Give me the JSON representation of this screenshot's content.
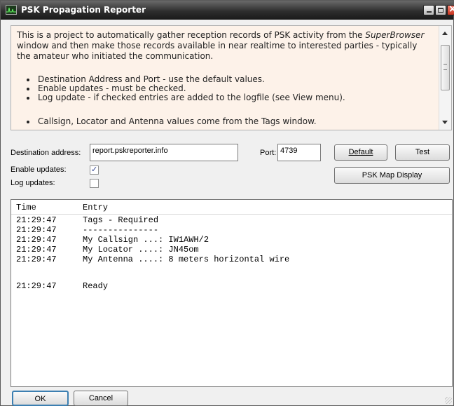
{
  "window": {
    "title": "PSK Propagation Reporter"
  },
  "info": {
    "para_before": "This is a project to automatically gather reception records of PSK activity from the ",
    "para_italic": "SuperBrowser",
    "para_after": " window and then make those records available in near realtime to interested parties - typically the amateur who initiated the communication.",
    "bullets": [
      "Destination Address and Port - use the default values.",
      "Enable updates - must be checked.",
      "Log update - if checked entries are added to the logfile (see View menu)."
    ],
    "bullets_2": [
      "Callsign, Locator and Antenna values come from the Tags window."
    ]
  },
  "form": {
    "dest_label": "Destination address:",
    "dest_value": "report.pskreporter.info",
    "port_label": "Port:",
    "port_value": "4739",
    "enable_label": "Enable updates:",
    "enable_checked": true,
    "log_label": "Log updates:",
    "log_checked": false,
    "default_button": "Default",
    "test_button": "Test",
    "map_button": "PSK Map Display"
  },
  "log": {
    "columns": [
      "Time",
      "Entry"
    ],
    "rows": [
      {
        "time": "21:29:47",
        "entry": "Tags - Required"
      },
      {
        "time": "21:29:47",
        "entry": "---------------"
      },
      {
        "time": "21:29:47",
        "entry": "My Callsign ...: IW1AWH/2"
      },
      {
        "time": "21:29:47",
        "entry": "My Locator ....: JN45om"
      },
      {
        "time": "21:29:47",
        "entry": "My Antenna ....: 8 meters horizontal wire"
      },
      {
        "time": "",
        "entry": ""
      },
      {
        "time": "21:29:47",
        "entry": "Ready"
      }
    ]
  },
  "buttons": {
    "ok": "OK",
    "cancel": "Cancel"
  }
}
